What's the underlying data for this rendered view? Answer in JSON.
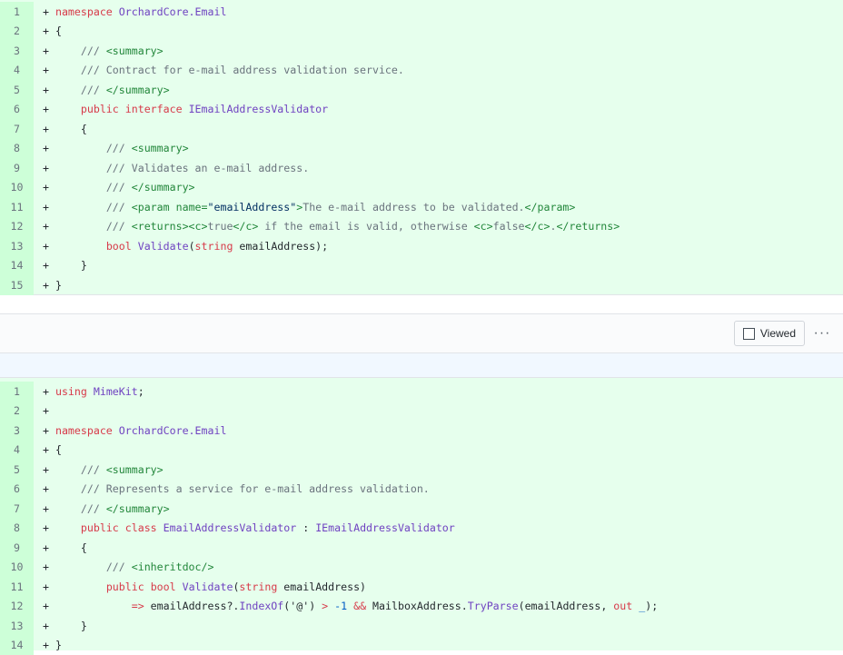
{
  "file1": {
    "lines": [
      {
        "n": "1",
        "tokens": [
          [
            "pl",
            "+ "
          ],
          [
            "kw",
            "namespace"
          ],
          [
            "pl",
            " "
          ],
          [
            "ty",
            "OrchardCore.Email"
          ]
        ]
      },
      {
        "n": "2",
        "tokens": [
          [
            "pl",
            "+ {"
          ]
        ]
      },
      {
        "n": "3",
        "tokens": [
          [
            "pl",
            "+     "
          ],
          [
            "cm",
            "/// "
          ],
          [
            "tg",
            "<summary>"
          ]
        ]
      },
      {
        "n": "4",
        "tokens": [
          [
            "pl",
            "+     "
          ],
          [
            "cm",
            "/// Contract for e-mail address validation service."
          ]
        ]
      },
      {
        "n": "5",
        "tokens": [
          [
            "pl",
            "+     "
          ],
          [
            "cm",
            "/// "
          ],
          [
            "tg",
            "</summary>"
          ]
        ]
      },
      {
        "n": "6",
        "tokens": [
          [
            "pl",
            "+     "
          ],
          [
            "kw",
            "public"
          ],
          [
            "pl",
            " "
          ],
          [
            "kw",
            "interface"
          ],
          [
            "pl",
            " "
          ],
          [
            "ty",
            "IEmailAddressValidator"
          ]
        ]
      },
      {
        "n": "7",
        "tokens": [
          [
            "pl",
            "+     {"
          ]
        ]
      },
      {
        "n": "8",
        "tokens": [
          [
            "pl",
            "+         "
          ],
          [
            "cm",
            "/// "
          ],
          [
            "tg",
            "<summary>"
          ]
        ]
      },
      {
        "n": "9",
        "tokens": [
          [
            "pl",
            "+         "
          ],
          [
            "cm",
            "/// Validates an e-mail address."
          ]
        ]
      },
      {
        "n": "10",
        "tokens": [
          [
            "pl",
            "+         "
          ],
          [
            "cm",
            "/// "
          ],
          [
            "tg",
            "</summary>"
          ]
        ]
      },
      {
        "n": "11",
        "tokens": [
          [
            "pl",
            "+         "
          ],
          [
            "cm",
            "/// "
          ],
          [
            "tg",
            "<param "
          ],
          [
            "tg",
            "name="
          ],
          [
            "st",
            "\"emailAddress\""
          ],
          [
            "tg",
            ">"
          ],
          [
            "cm",
            "The e-mail address to be validated."
          ],
          [
            "tg",
            "</param>"
          ]
        ]
      },
      {
        "n": "12",
        "tokens": [
          [
            "pl",
            "+         "
          ],
          [
            "cm",
            "/// "
          ],
          [
            "tg",
            "<returns><c>"
          ],
          [
            "cm",
            "true"
          ],
          [
            "tg",
            "</c>"
          ],
          [
            "cm",
            " if the email is valid, otherwise "
          ],
          [
            "tg",
            "<c>"
          ],
          [
            "cm",
            "false"
          ],
          [
            "tg",
            "</c>"
          ],
          [
            "cm",
            "."
          ],
          [
            "tg",
            "</returns>"
          ]
        ]
      },
      {
        "n": "13",
        "tokens": [
          [
            "pl",
            "+         "
          ],
          [
            "kw",
            "bool"
          ],
          [
            "pl",
            " "
          ],
          [
            "ty",
            "Validate"
          ],
          [
            "pl",
            "("
          ],
          [
            "kw",
            "string"
          ],
          [
            "pl",
            " emailAddress);"
          ]
        ]
      },
      {
        "n": "14",
        "tokens": [
          [
            "pl",
            "+     }"
          ]
        ]
      },
      {
        "n": "15",
        "tokens": [
          [
            "pl",
            "+ }"
          ]
        ]
      }
    ]
  },
  "file_header": {
    "viewed_label": "Viewed",
    "more_label": "···"
  },
  "file2": {
    "lines": [
      {
        "n": "1",
        "tokens": [
          [
            "pl",
            "+ "
          ],
          [
            "kw",
            "using"
          ],
          [
            "pl",
            " "
          ],
          [
            "ty",
            "MimeKit"
          ],
          [
            "pl",
            ";"
          ]
        ]
      },
      {
        "n": "2",
        "tokens": [
          [
            "pl",
            "+"
          ]
        ]
      },
      {
        "n": "3",
        "tokens": [
          [
            "pl",
            "+ "
          ],
          [
            "kw",
            "namespace"
          ],
          [
            "pl",
            " "
          ],
          [
            "ty",
            "OrchardCore.Email"
          ]
        ]
      },
      {
        "n": "4",
        "tokens": [
          [
            "pl",
            "+ {"
          ]
        ]
      },
      {
        "n": "5",
        "tokens": [
          [
            "pl",
            "+     "
          ],
          [
            "cm",
            "/// "
          ],
          [
            "tg",
            "<summary>"
          ]
        ]
      },
      {
        "n": "6",
        "tokens": [
          [
            "pl",
            "+     "
          ],
          [
            "cm",
            "/// Represents a service for e-mail address validation."
          ]
        ]
      },
      {
        "n": "7",
        "tokens": [
          [
            "pl",
            "+     "
          ],
          [
            "cm",
            "/// "
          ],
          [
            "tg",
            "</summary>"
          ]
        ]
      },
      {
        "n": "8",
        "tokens": [
          [
            "pl",
            "+     "
          ],
          [
            "kw",
            "public"
          ],
          [
            "pl",
            " "
          ],
          [
            "kw",
            "class"
          ],
          [
            "pl",
            " "
          ],
          [
            "ty",
            "EmailAddressValidator"
          ],
          [
            "pl",
            " : "
          ],
          [
            "ty",
            "IEmailAddressValidator"
          ]
        ]
      },
      {
        "n": "9",
        "tokens": [
          [
            "pl",
            "+     {"
          ]
        ]
      },
      {
        "n": "10",
        "tokens": [
          [
            "pl",
            "+         "
          ],
          [
            "cm",
            "/// "
          ],
          [
            "tg",
            "<inheritdoc/>"
          ]
        ]
      },
      {
        "n": "11",
        "tokens": [
          [
            "pl",
            "+         "
          ],
          [
            "kw",
            "public"
          ],
          [
            "pl",
            " "
          ],
          [
            "kw",
            "bool"
          ],
          [
            "pl",
            " "
          ],
          [
            "ty",
            "Validate"
          ],
          [
            "pl",
            "("
          ],
          [
            "kw",
            "string"
          ],
          [
            "pl",
            " emailAddress)"
          ]
        ]
      },
      {
        "n": "12",
        "tokens": [
          [
            "pl",
            "+             "
          ],
          [
            "kw",
            "=>"
          ],
          [
            "pl",
            " emailAddress?."
          ],
          [
            "ty",
            "IndexOf"
          ],
          [
            "pl",
            "('@') "
          ],
          [
            "kw",
            ">"
          ],
          [
            "pl",
            " "
          ],
          [
            "nu",
            "-1"
          ],
          [
            "pl",
            " "
          ],
          [
            "kw",
            "&&"
          ],
          [
            "pl",
            " MailboxAddress."
          ],
          [
            "ty",
            "TryParse"
          ],
          [
            "pl",
            "(emailAddress, "
          ],
          [
            "kw",
            "out"
          ],
          [
            "pl",
            " "
          ],
          [
            "nu",
            "_"
          ],
          [
            "pl",
            ");"
          ]
        ]
      },
      {
        "n": "13",
        "tokens": [
          [
            "pl",
            "+     }"
          ]
        ]
      },
      {
        "n": "14",
        "tokens": [
          [
            "pl",
            "+ }"
          ]
        ]
      }
    ]
  }
}
